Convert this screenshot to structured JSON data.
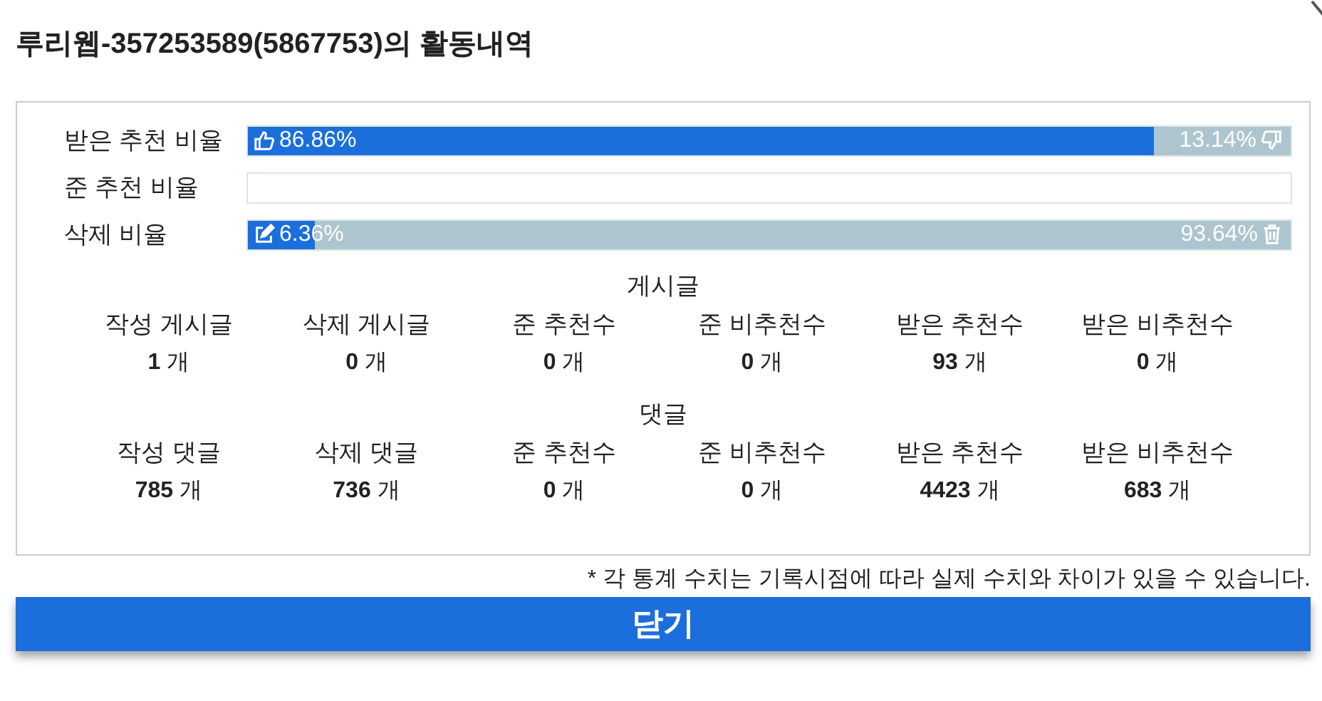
{
  "title": "루리웹-357253589(5867753)의 활동내역",
  "ratios": [
    {
      "label": "받은 추천 비율",
      "kind": "recommend",
      "level": 0.8686,
      "left_text": "86.86%",
      "right_text": "13.14%"
    },
    {
      "label": "준 추천 비율",
      "kind": "given",
      "level": 0
    },
    {
      "label": "삭제 비율",
      "kind": "delete",
      "level": 0.0636,
      "left_text": "6.36%",
      "right_text": "93.64%"
    }
  ],
  "sections": [
    {
      "heading": "게시글",
      "stats": [
        {
          "label": "작성 게시글",
          "value": "**1** 개"
        },
        {
          "label": "삭제 게시글",
          "value": "**0** 개"
        },
        {
          "label": "준 추천수",
          "value": "**0** 개"
        },
        {
          "label": "준 비추천수",
          "value": "**0** 개"
        },
        {
          "label": "받은 추천수",
          "value": "**93** 개"
        },
        {
          "label": "받은 비추천수",
          "value": "**0** 개"
        }
      ]
    },
    {
      "heading": "댓글",
      "stats": [
        {
          "label": "작성 댓글",
          "value": "**785** 개"
        },
        {
          "label": "삭제 댓글",
          "value": "**736** 개"
        },
        {
          "label": "준 추천수",
          "value": "**0** 개"
        },
        {
          "label": "준 비추천수",
          "value": "**0** 개"
        },
        {
          "label": "받은 추천수",
          "value": "**4423** 개"
        },
        {
          "label": "받은 비추천수",
          "value": "**683** 개"
        }
      ]
    }
  ],
  "note": "* 각 통계 수치는 기록시점에 따라 실제 수치와 차이가 있을 수 있습니다.",
  "close_button": "닫기"
}
